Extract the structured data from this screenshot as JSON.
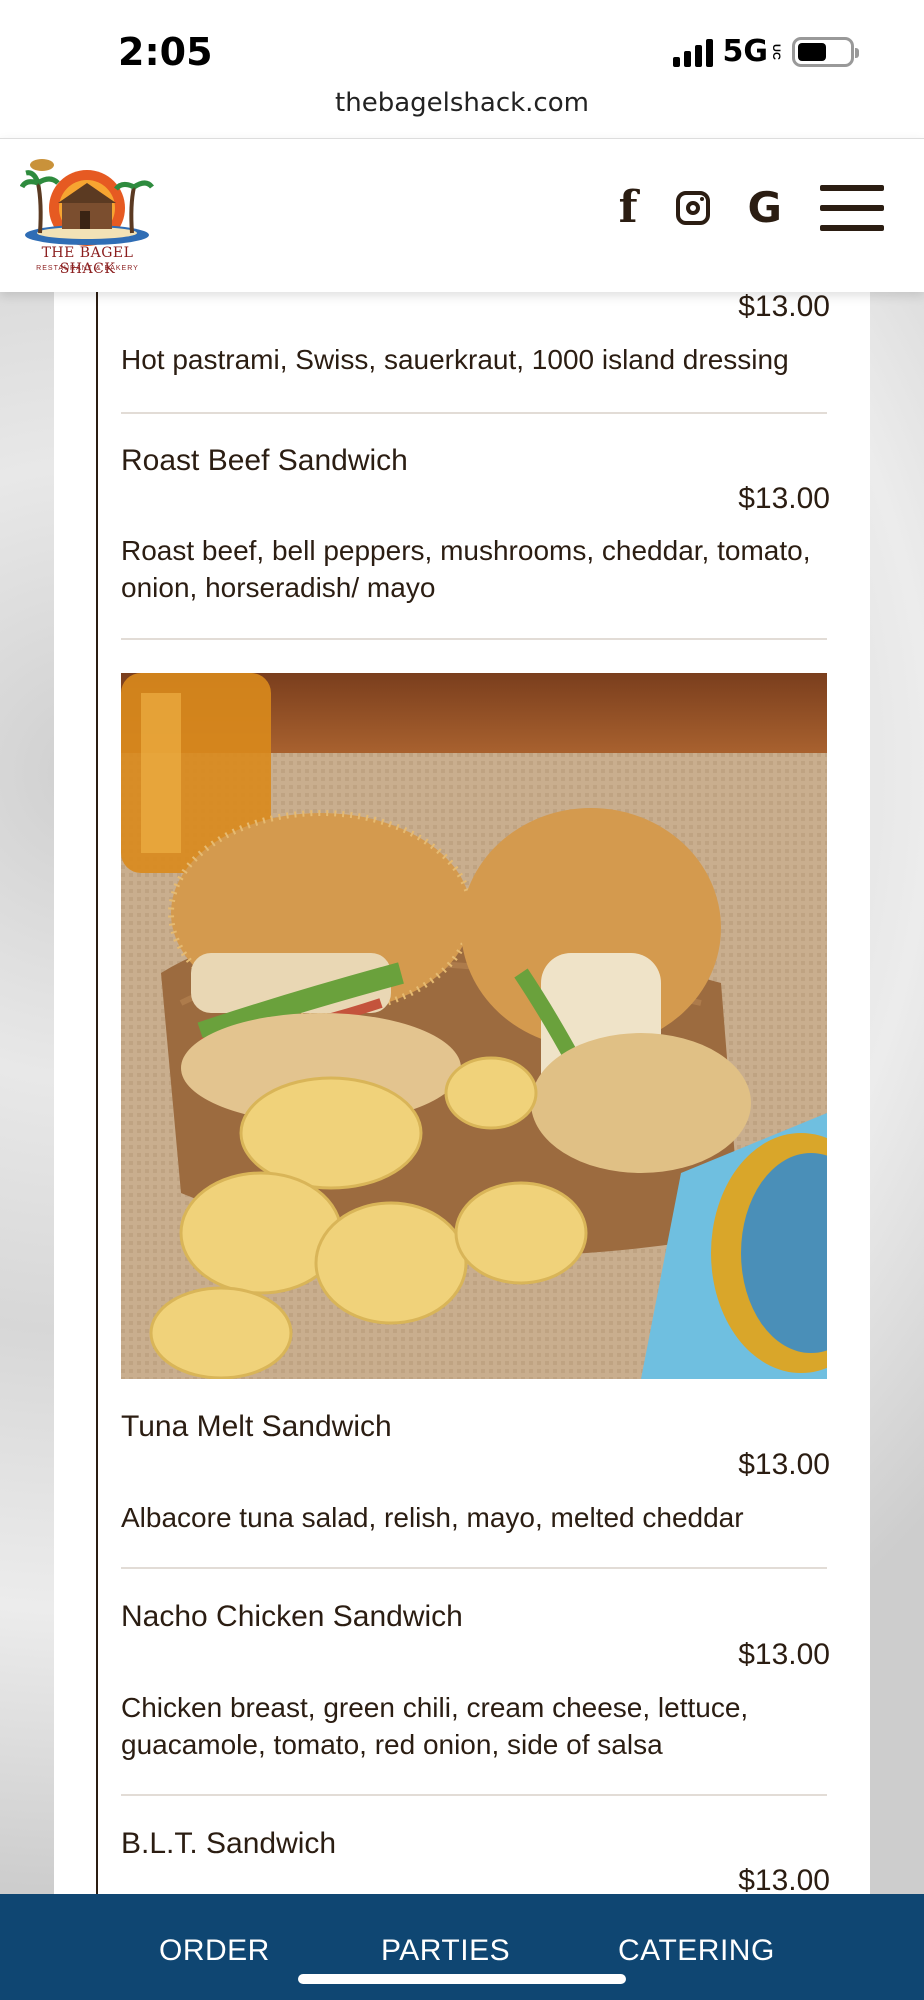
{
  "status_bar": {
    "time": "2:05",
    "network": "5G",
    "network_badge": "UC"
  },
  "browser": {
    "url": "thebagelshack.com"
  },
  "header": {
    "logo_text": "THE BAGEL SHACK",
    "logo_subtext": "RESTAURANT & BAKERY",
    "icons": [
      "facebook-icon",
      "instagram-icon",
      "google-icon",
      "hamburger-menu-icon"
    ]
  },
  "menu": {
    "items": [
      {
        "name": "",
        "price": "$13.00",
        "description": "Hot pastrami, Swiss, sauerkraut, 1000 island dressing"
      },
      {
        "name": "Roast Beef Sandwich",
        "price": "$13.00",
        "description": "Roast beef, bell peppers, mushrooms, cheddar, tomato, onion, horseradish/ mayo"
      },
      {
        "name": "Tuna Melt Sandwich",
        "price": "$13.00",
        "description": "Albacore tuna salad, relish, mayo, melted cheddar"
      },
      {
        "name": "Nacho Chicken Sandwich",
        "price": "$13.00",
        "description": "Chicken breast, green chili, cream cheese, lettuce, guacamole, tomato, red onion, side of salsa"
      },
      {
        "name": "B.L.T. Sandwich",
        "price": "$13.00",
        "description": ""
      }
    ]
  },
  "bottom_nav": {
    "order": "ORDER",
    "parties": "PARTIES",
    "catering": "CATERING"
  },
  "colors": {
    "nav_bg": "#0f4672",
    "text": "#2b1d12",
    "accent_logo": "#8b1e1e"
  }
}
